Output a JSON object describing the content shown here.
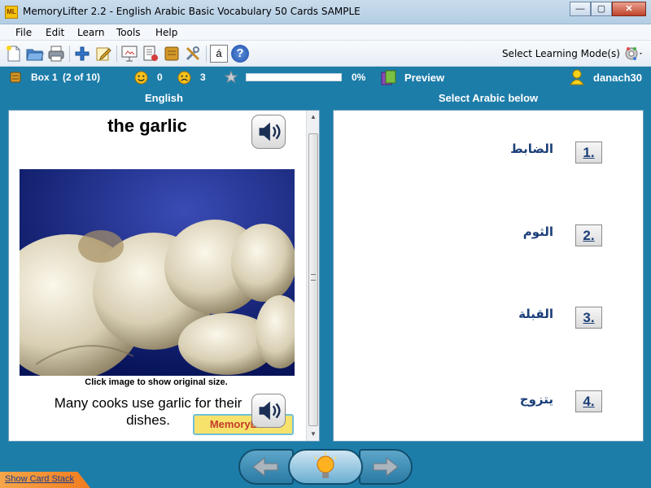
{
  "window": {
    "app_icon_text": "ML",
    "title": "MemoryLifter 2.2 - English Arabic Basic Vocabulary 50 Cards SAMPLE",
    "minimize_glyph": "—",
    "maximize_glyph": "▢",
    "close_glyph": "✕"
  },
  "menu": {
    "file": "File",
    "edit": "Edit",
    "learn": "Learn",
    "tools": "Tools",
    "help": "Help"
  },
  "toolbar": {
    "icons": [
      "new-file-icon",
      "open-folder-icon",
      "print-icon",
      "add-icon",
      "edit-icon",
      "slideshow-icon",
      "card-list-icon",
      "box-icon",
      "tools-icon",
      "character-icon",
      "help-icon"
    ],
    "character_glyph": "á",
    "help_glyph": "?",
    "mode_label": "Select Learning Mode(s)"
  },
  "status": {
    "box": "Box 1",
    "box_position": "(2 of 10)",
    "correct_count": "0",
    "wrong_count": "3",
    "progress_percent": 0,
    "progress_label": "0%",
    "preview": "Preview",
    "user": "danach30"
  },
  "headers": {
    "question": "English",
    "answer": "Select Arabic below"
  },
  "question": {
    "word": "the garlic",
    "caption": "Click image to show original size.",
    "example": "Many cooks use garlic for their dishes.",
    "logo_text": "MemoryLifter"
  },
  "answers": [
    {
      "num": "1.",
      "text": "الضابط"
    },
    {
      "num": "2.",
      "text": "الثوم"
    },
    {
      "num": "3.",
      "text": "القبلة"
    },
    {
      "num": "4.",
      "text": "يتزوج"
    }
  ],
  "footer": {
    "show_card_stack": "Show Card Stack"
  },
  "colors": {
    "accent": "#1d7da9",
    "answer_text": "#1b3f78",
    "progress_fill": "#7bc143"
  }
}
